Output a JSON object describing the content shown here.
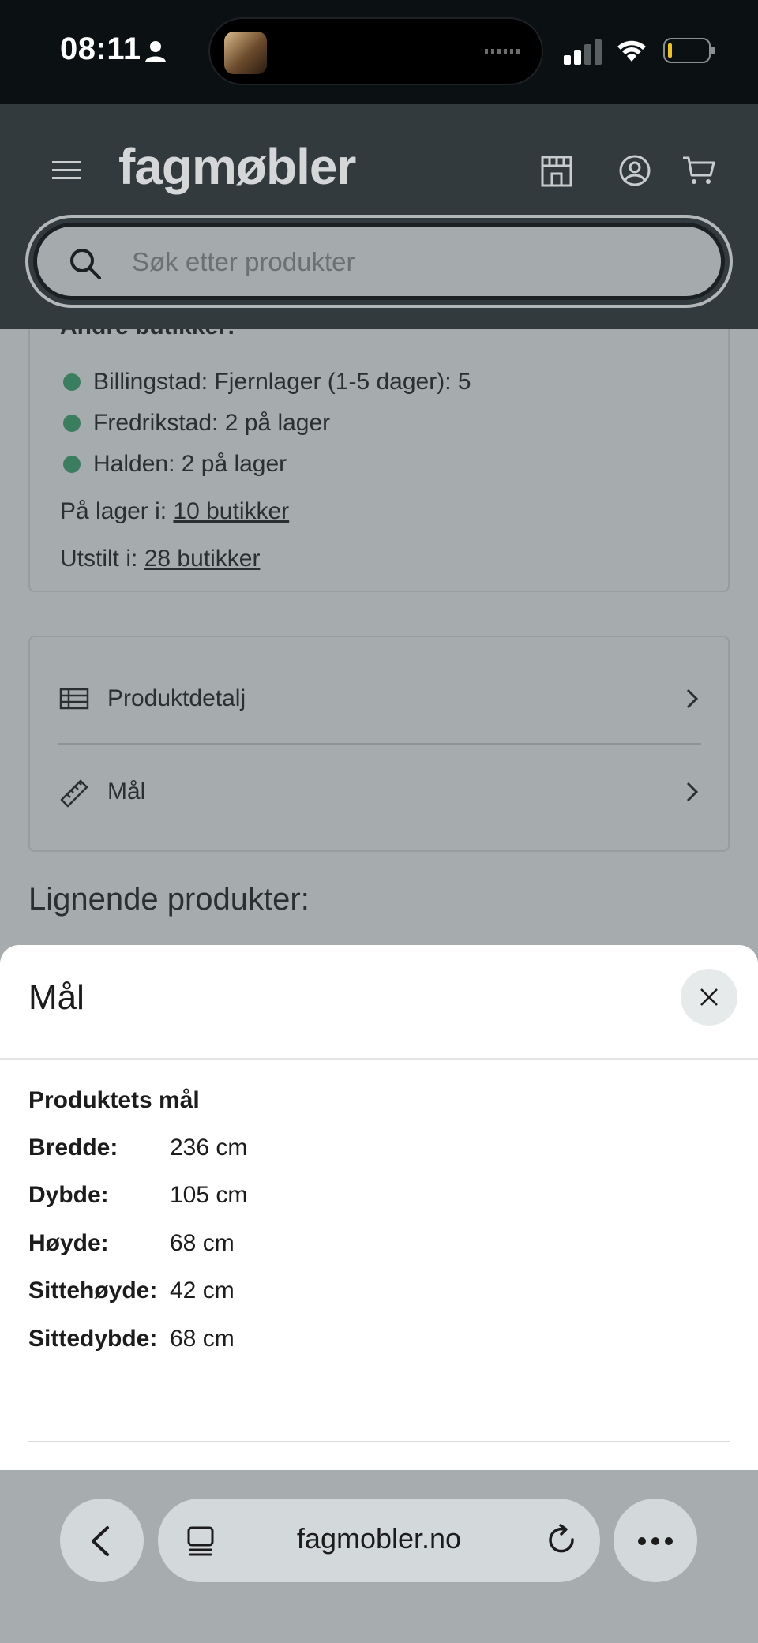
{
  "status_bar": {
    "time": "08:11"
  },
  "header": {
    "logo": "fagmøbler",
    "search": {
      "placeholder": "Søk etter produkter"
    }
  },
  "stores": {
    "heading": "Andre butikker:",
    "items": [
      {
        "label": "Billingstad: Fjernlager (1-5 dager): 5",
        "status_color": "#3b7d5f"
      },
      {
        "label": "Fredrikstad: 2 på lager",
        "status_color": "#3b7d5f"
      },
      {
        "label": "Halden: 2 på lager",
        "status_color": "#3b7d5f"
      }
    ],
    "in_stock_label": "På lager i:",
    "in_stock_link": "10 butikker",
    "displayed_label": "Utstilt i:",
    "displayed_link": "28 butikker"
  },
  "details": {
    "items": [
      {
        "label": "Produktdetalj",
        "icon": "table-icon"
      },
      {
        "label": "Mål",
        "icon": "ruler-icon"
      }
    ]
  },
  "similar_products": {
    "title": "Lignende produkter:"
  },
  "sheet": {
    "title": "Mål",
    "section_heading": "Produktets mål",
    "dimensions": [
      {
        "key": "Bredde:",
        "value": "236 cm"
      },
      {
        "key": "Dybde:",
        "value": "105 cm"
      },
      {
        "key": "Høyde:",
        "value": "68 cm"
      },
      {
        "key": "Sittehøyde:",
        "value": "42 cm"
      },
      {
        "key": "Sittedybde:",
        "value": "68 cm"
      }
    ]
  },
  "browser": {
    "url": "fagmobler.no"
  }
}
